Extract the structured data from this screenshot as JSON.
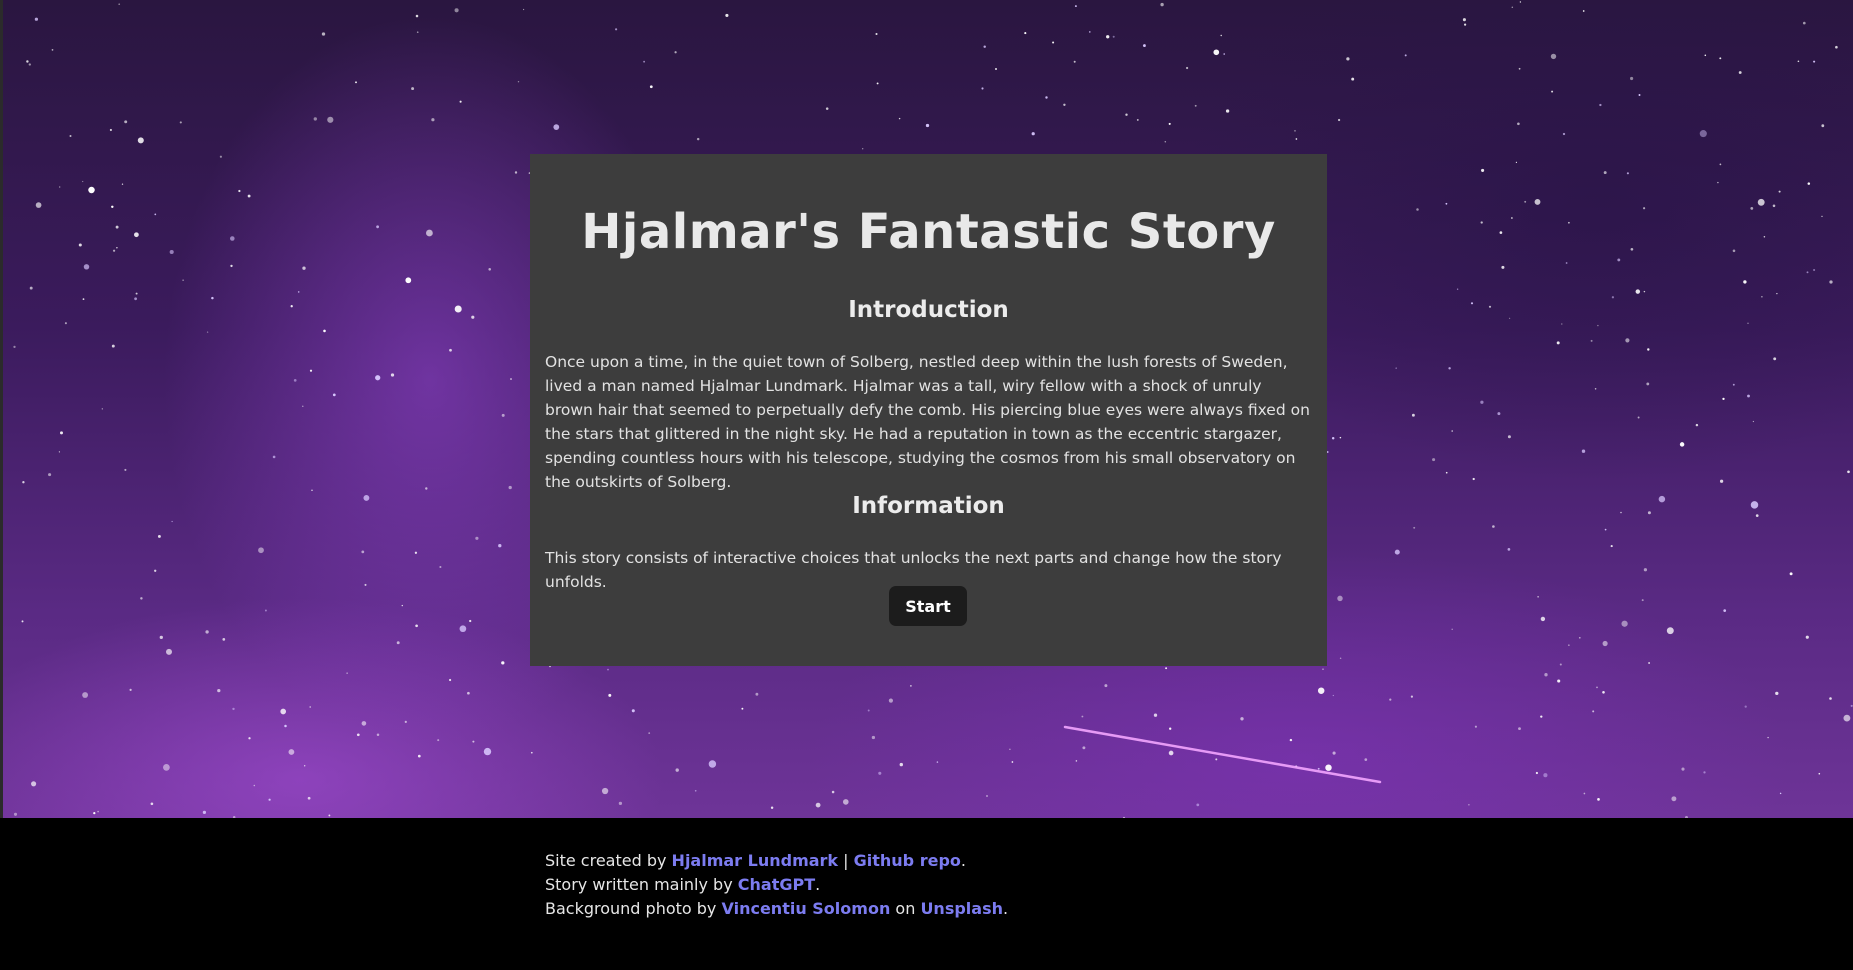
{
  "card": {
    "title": "Hjalmar's Fantastic Story",
    "introduction_heading": "Introduction",
    "introduction_text": "Once upon a time, in the quiet town of Solberg, nestled deep within the lush forests of Sweden, lived a man named Hjalmar Lundmark. Hjalmar was a tall, wiry fellow with a shock of unruly brown hair that seemed to perpetually defy the comb. His piercing blue eyes were always fixed on the stars that glittered in the night sky. He had a reputation in town as the eccentric stargazer, spending countless hours with his telescope, studying the cosmos from his small observatory on the outskirts of Solberg.",
    "information_heading": "Information",
    "information_text": "This story consists of interactive choices that unlocks the next parts and change how the story unfolds.",
    "start_label": "Start"
  },
  "footer": {
    "line1_prefix": "Site created by ",
    "author_link": "Hjalmar Lundmark",
    "separator": " | ",
    "repo_link": "Github repo",
    "line1_suffix": ".",
    "line2_prefix": "Story written mainly by ",
    "chatgpt_link": "ChatGPT",
    "line2_suffix": ".",
    "line3_prefix": "Background photo by ",
    "photographer_link": "Vincentiu Solomon",
    "line3_middle": " on ",
    "unsplash_link": "Unsplash",
    "line3_suffix": "."
  },
  "colors": {
    "card_background": "#3d3d3d",
    "button_background": "#1c1c1c",
    "link": "#7c7cf0",
    "footer_background": "#000000"
  }
}
